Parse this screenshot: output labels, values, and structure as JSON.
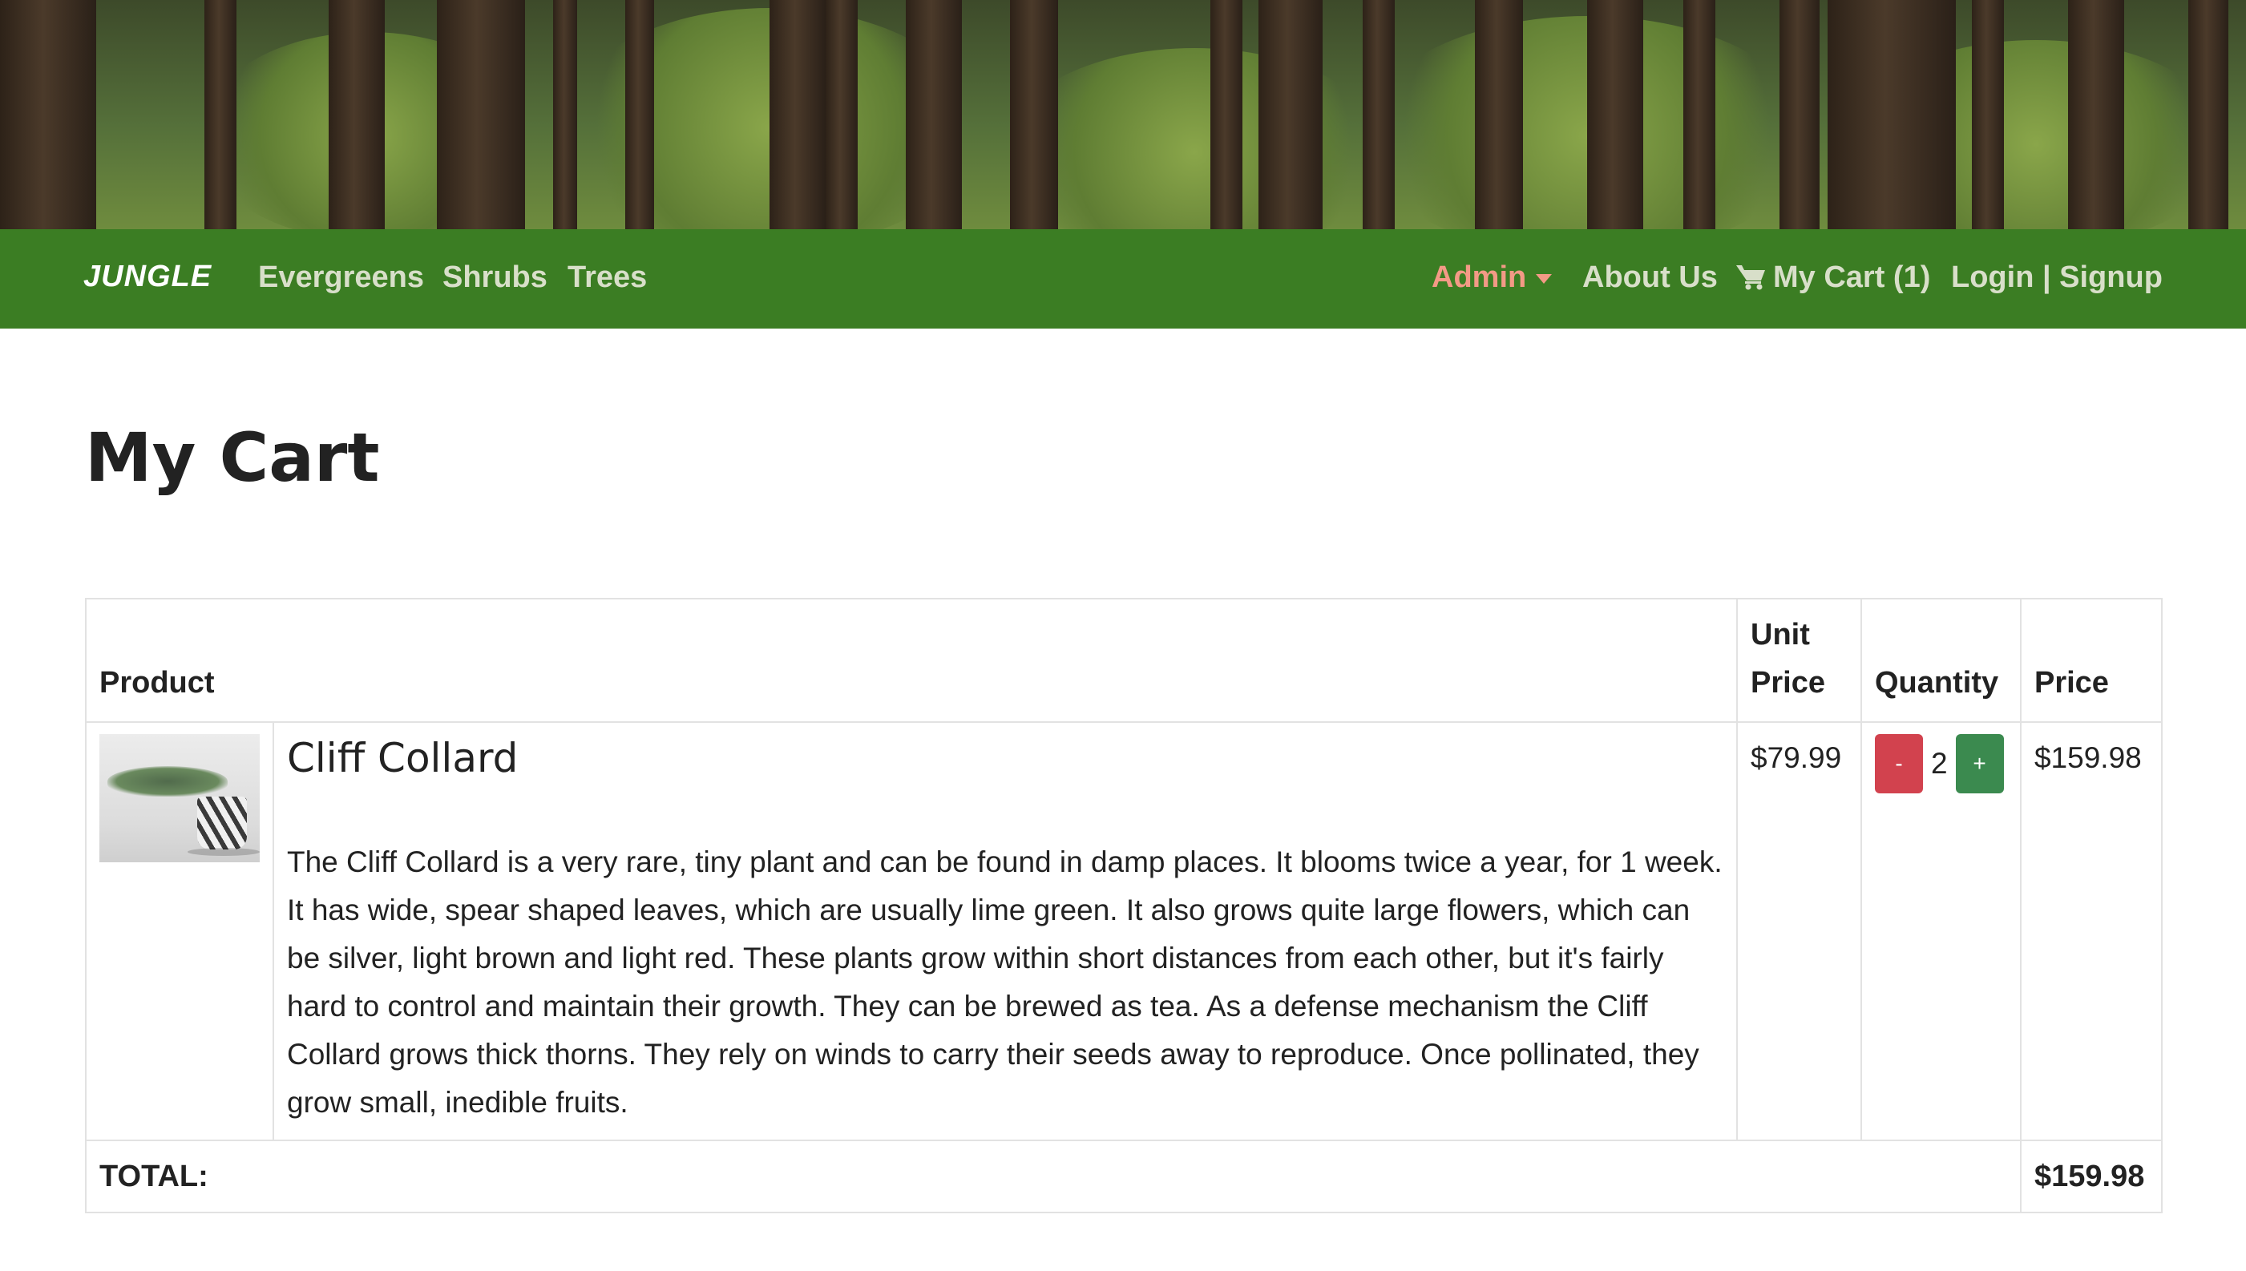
{
  "navbar": {
    "brand": "JUNGLE",
    "links": [
      "Evergreens",
      "Shrubs",
      "Trees"
    ],
    "admin_label": "Admin",
    "about_label": "About Us",
    "cart_label": "My Cart (1)",
    "auth_label": "Login | Signup",
    "colors": {
      "background": "#3b7d23",
      "link": "#d8dfc9",
      "admin": "#f39a86"
    }
  },
  "page": {
    "title": "My Cart"
  },
  "cart": {
    "headers": {
      "product": "Product",
      "unit_price": "Unit Price",
      "quantity": "Quantity",
      "price": "Price"
    },
    "items": [
      {
        "name": "Cliff Collard",
        "description": "The Cliff Collard is a very rare, tiny plant and can be found in damp places. It blooms twice a year, for 1 week. It has wide, spear shaped leaves, which are usually lime green. It also grows quite large flowers, which can be silver, light brown and light red. These plants grow within short distances from each other, but it's fairly hard to control and maintain their growth. They can be brewed as tea. As a defense mechanism the Cliff Collard grows thick thorns. They rely on winds to carry their seeds away to reproduce. Once pollinated, they grow small, inedible fruits.",
        "unit_price": "$79.99",
        "quantity": "2",
        "minus_label": "-",
        "plus_label": "+",
        "price": "$159.98"
      }
    ],
    "total_label": "TOTAL:",
    "total_value": "$159.98"
  }
}
